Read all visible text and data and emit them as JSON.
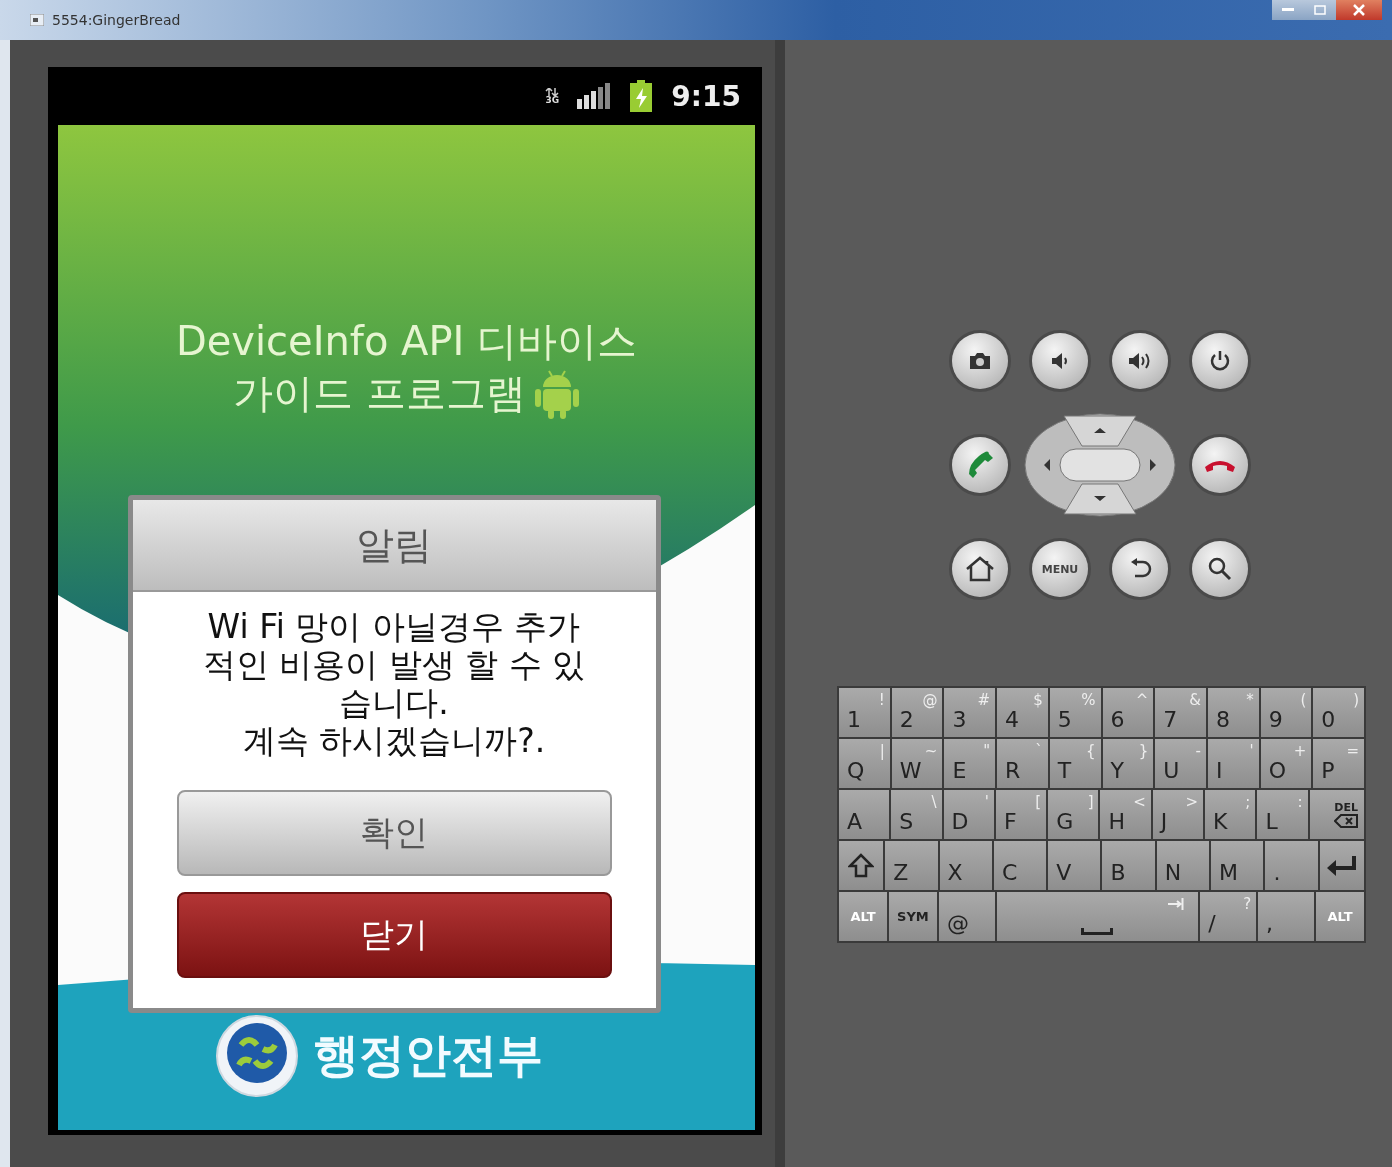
{
  "window": {
    "title": "5554:GingerBread"
  },
  "status_bar": {
    "network": "3G",
    "time": "9:15"
  },
  "app": {
    "title_lines": [
      "DeviceInfo API 디바이스",
      "가이드 프로그램"
    ],
    "footer_text": "행정안전부"
  },
  "dialog": {
    "title": "알림",
    "message": "Wi Fi 망이 아닐경우 추가적인 비용이 발생 할 수 있습니다.\n계속 하시겠습니까?.",
    "buttons": [
      {
        "label": "확인",
        "kind": "neutral"
      },
      {
        "label": "닫기",
        "kind": "danger"
      }
    ]
  },
  "controls": {
    "menu_label": "MENU"
  },
  "keyboard": {
    "rows": [
      [
        {
          "kind": "char",
          "label": "1",
          "alt": "!"
        },
        {
          "kind": "char",
          "label": "2",
          "alt": "@"
        },
        {
          "kind": "char",
          "label": "3",
          "alt": "#"
        },
        {
          "kind": "char",
          "label": "4",
          "alt": "$"
        },
        {
          "kind": "char",
          "label": "5",
          "alt": "%"
        },
        {
          "kind": "char",
          "label": "6",
          "alt": "^"
        },
        {
          "kind": "char",
          "label": "7",
          "alt": "&"
        },
        {
          "kind": "char",
          "label": "8",
          "alt": "*"
        },
        {
          "kind": "char",
          "label": "9",
          "alt": "("
        },
        {
          "kind": "char",
          "label": "0",
          "alt": ")"
        }
      ],
      [
        {
          "kind": "char",
          "label": "Q",
          "alt": "|"
        },
        {
          "kind": "char",
          "label": "W",
          "alt": "~"
        },
        {
          "kind": "char",
          "label": "E",
          "alt": "\""
        },
        {
          "kind": "char",
          "label": "R",
          "alt": "`"
        },
        {
          "kind": "char",
          "label": "T",
          "alt": "{"
        },
        {
          "kind": "char",
          "label": "Y",
          "alt": "}"
        },
        {
          "kind": "char",
          "label": "U",
          "alt": "-"
        },
        {
          "kind": "char",
          "label": "I",
          "alt": "'"
        },
        {
          "kind": "char",
          "label": "O",
          "alt": "+"
        },
        {
          "kind": "char",
          "label": "P",
          "alt": "="
        }
      ],
      [
        {
          "kind": "char",
          "label": "A"
        },
        {
          "kind": "char",
          "label": "S",
          "alt": "\\"
        },
        {
          "kind": "char",
          "label": "D",
          "alt": "'"
        },
        {
          "kind": "char",
          "label": "F",
          "alt": "["
        },
        {
          "kind": "char",
          "label": "G",
          "alt": "]"
        },
        {
          "kind": "char",
          "label": "H",
          "alt": "<"
        },
        {
          "kind": "char",
          "label": "J",
          "alt": ">"
        },
        {
          "kind": "char",
          "label": "K",
          "alt": ";"
        },
        {
          "kind": "char",
          "label": "L",
          "alt": ":"
        },
        {
          "kind": "del",
          "label": "DEL"
        }
      ],
      [
        {
          "kind": "shift"
        },
        {
          "kind": "char",
          "label": "Z"
        },
        {
          "kind": "char",
          "label": "X"
        },
        {
          "kind": "char",
          "label": "C"
        },
        {
          "kind": "char",
          "label": "V"
        },
        {
          "kind": "char",
          "label": "B"
        },
        {
          "kind": "char",
          "label": "N"
        },
        {
          "kind": "char",
          "label": "M"
        },
        {
          "kind": "char",
          "label": "."
        },
        {
          "kind": "enter"
        }
      ]
    ],
    "bottom_row": [
      {
        "kind": "mod",
        "label": "ALT"
      },
      {
        "kind": "mod",
        "label": "SYM"
      },
      {
        "kind": "char",
        "label": "@"
      },
      {
        "kind": "space"
      },
      {
        "kind": "char",
        "label": "/",
        "alt": "?"
      },
      {
        "kind": "char",
        "label": ","
      },
      {
        "kind": "mod",
        "label": "ALT"
      }
    ]
  }
}
